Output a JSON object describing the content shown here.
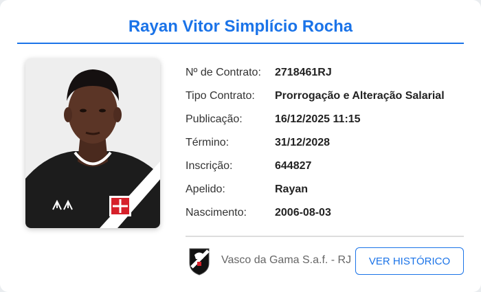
{
  "player": {
    "name": "Rayan Vitor Simplício Rocha"
  },
  "fields": [
    {
      "label": "Nº de Contrato:",
      "value": "2718461RJ"
    },
    {
      "label": "Tipo Contrato:",
      "value": "Prorrogação e Alteração Salarial"
    },
    {
      "label": "Publicação:",
      "value": "16/12/2025 11:15"
    },
    {
      "label": "Término:",
      "value": "31/12/2028"
    },
    {
      "label": "Inscrição:",
      "value": "644827"
    },
    {
      "label": "Apelido:",
      "value": "Rayan"
    },
    {
      "label": "Nascimento:",
      "value": "2006-08-03"
    }
  ],
  "club": {
    "name": "Vasco da Gama S.a.f. - RJ"
  },
  "actions": {
    "history_label": "VER HISTÓRICO"
  },
  "colors": {
    "accent": "#1a73e8",
    "jersey": "#1c1c1c",
    "sash": "#ffffff",
    "cross": "#d6202a"
  }
}
